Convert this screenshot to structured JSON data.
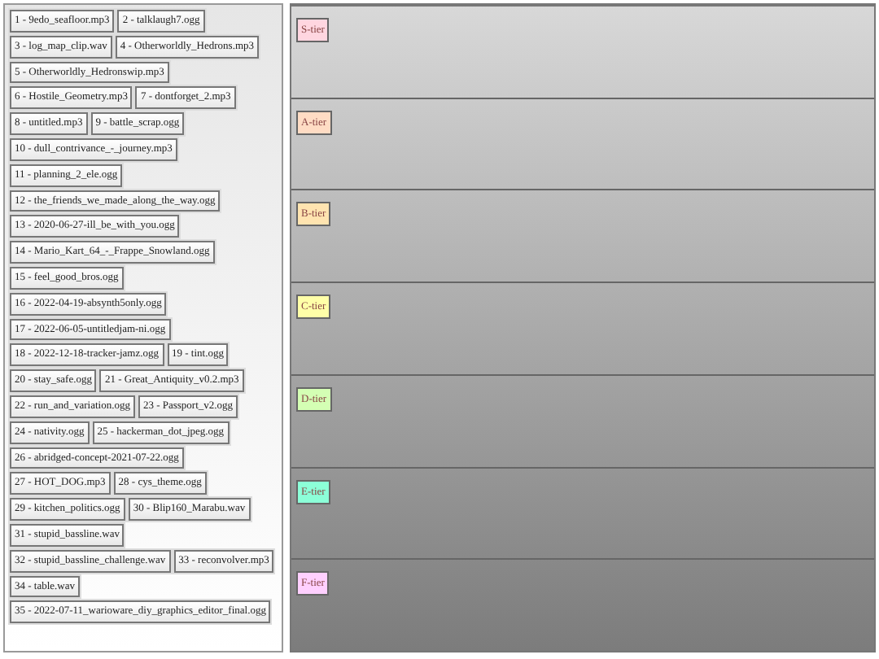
{
  "tracks": [
    "1 - 9edo_seafloor.mp3",
    "2 - talklaugh7.ogg",
    "3 - log_map_clip.wav",
    "4 - Otherworldly_Hedrons.mp3",
    "5 - Otherworldly_Hedronswip.mp3",
    "6 - Hostile_Geometry.mp3",
    "7 - dontforget_2.mp3",
    "8 - untitled.mp3",
    "9 - battle_scrap.ogg",
    "10 - dull_contrivance_-_journey.mp3",
    "11 - planning_2_ele.ogg",
    "12 - the_friends_we_made_along_the_way.ogg",
    "13 - 2020-06-27-ill_be_with_you.ogg",
    "14 - Mario_Kart_64_-_Frappe_Snowland.ogg",
    "15 - feel_good_bros.ogg",
    "16 - 2022-04-19-absynth5only.ogg",
    "17 - 2022-06-05-untitledjam-ni.ogg",
    "18 - 2022-12-18-tracker-jamz.ogg",
    "19 - tint.ogg",
    "20 - stay_safe.ogg",
    "21 - Great_Antiquity_v0.2.mp3",
    "22 - run_and_variation.ogg",
    "23 - Passport_v2.ogg",
    "24 - nativity.ogg",
    "25 - hackerman_dot_jpeg.ogg",
    "26 - abridged-concept-2021-07-22.ogg",
    "27 - HOT_DOG.mp3",
    "28 - cys_theme.ogg",
    "29 - kitchen_politics.ogg",
    "30 - Blip160_Marabu.wav",
    "31 - stupid_bassline.wav",
    "32 - stupid_bassline_challenge.wav",
    "33 - reconvolver.mp3",
    "34 - table.wav",
    "35 - 2022-07-11_warioware_diy_graphics_editor_final.ogg"
  ],
  "tiers": [
    {
      "label": "S-tier",
      "color": "#ffd6e0"
    },
    {
      "label": "A-tier",
      "color": "#ffdcc4"
    },
    {
      "label": "B-tier",
      "color": "#ffe4b0"
    },
    {
      "label": "C-tier",
      "color": "#ffffa8"
    },
    {
      "label": "D-tier",
      "color": "#d4ffb4"
    },
    {
      "label": "E-tier",
      "color": "#8cffd8"
    },
    {
      "label": "F-tier",
      "color": "#ffd0ff"
    }
  ]
}
